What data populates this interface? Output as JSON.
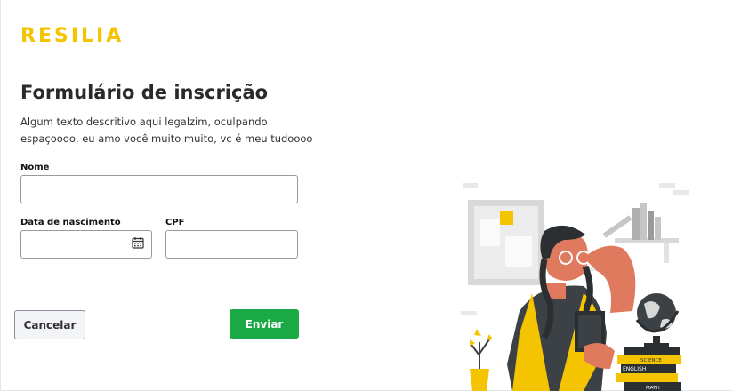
{
  "brand": {
    "logo": "RESILIA",
    "color": "#f5c400"
  },
  "form": {
    "title": "Formulário de inscrição",
    "description": "Algum texto descritivo aqui legalzim, oculpando espaçoooo, eu amo você muito muito, vc é meu tudoooo",
    "fields": {
      "nome": {
        "label": "Nome",
        "value": ""
      },
      "nascimento": {
        "label": "Data de nascimento",
        "value": "",
        "icon": "calendar-icon"
      },
      "cpf": {
        "label": "CPF",
        "value": ""
      }
    },
    "buttons": {
      "cancel": "Cancelar",
      "submit": "Enviar"
    }
  },
  "illustration": {
    "book_labels": [
      "SCIENCE",
      "ENGLISH",
      "MATH"
    ]
  }
}
